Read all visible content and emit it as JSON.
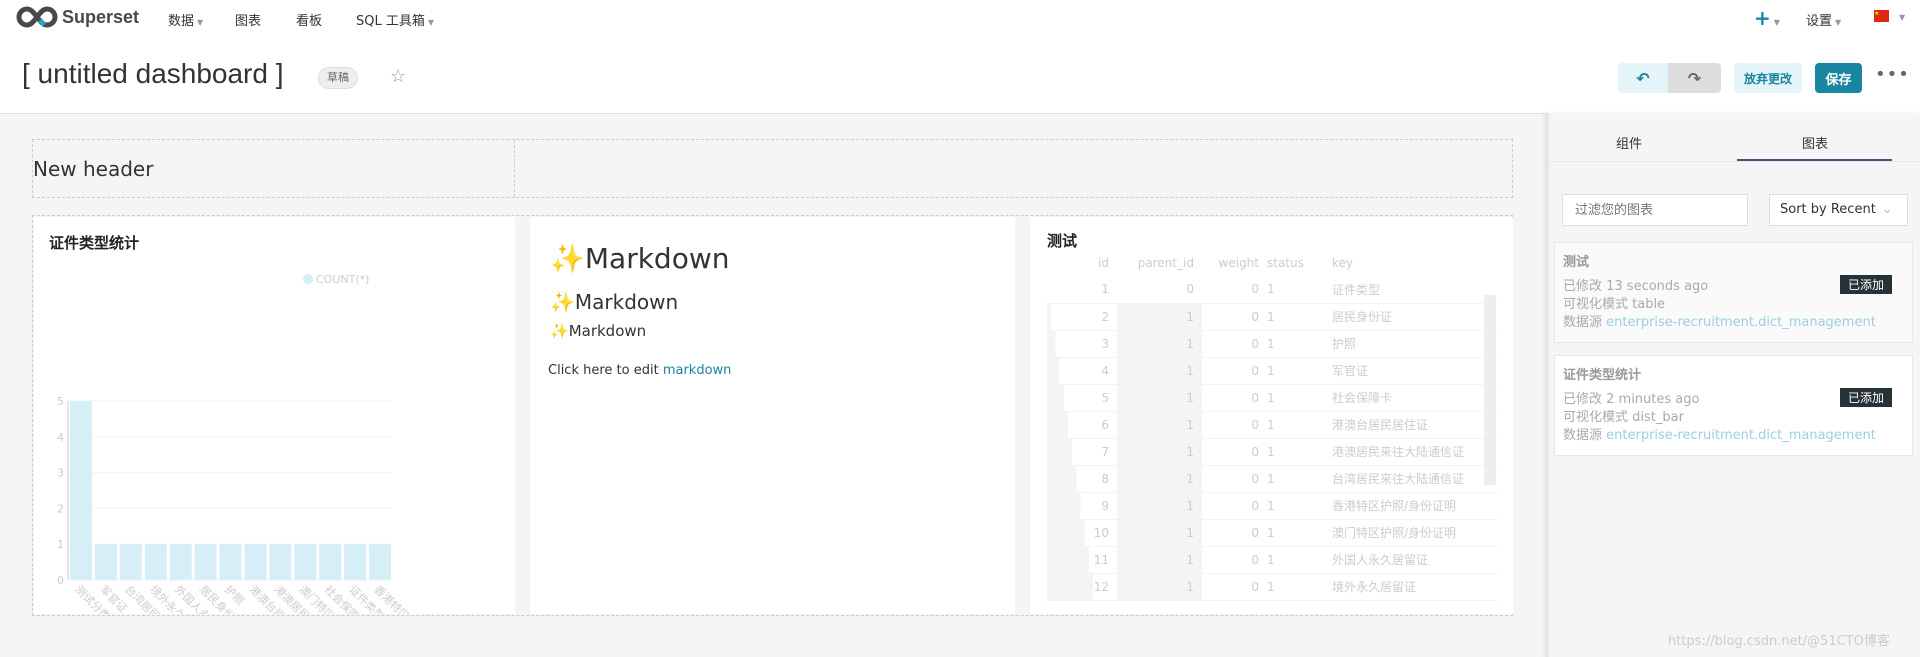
{
  "nav": {
    "brand": "Superset",
    "items": [
      {
        "label": "数据",
        "caret": true
      },
      {
        "label": "图表",
        "caret": false
      },
      {
        "label": "看板",
        "caret": false
      },
      {
        "label": "SQL 工具箱",
        "caret": true
      }
    ],
    "plus_icon": "plus-icon",
    "settings": "设置",
    "language_icon": "china-flag-icon"
  },
  "header": {
    "title": "[ untitled dashboard ]",
    "badge": "草稿",
    "undo_icon": "undo-icon",
    "redo_icon": "redo-icon",
    "discard": "放弃更改",
    "save": "保存",
    "more_icon": "ellipsis-icon"
  },
  "colors": {
    "primary": "#1a85a0",
    "bar": "#d6eef5",
    "dark": "#263238"
  },
  "dashboard": {
    "header_text": "New header",
    "chart1": {
      "title": "证件类型统计"
    },
    "markdown": {
      "h1": "Markdown",
      "h2": "Markdown",
      "h3": "Markdown",
      "edit_prefix": "Click here to edit ",
      "edit_link": "markdown"
    },
    "table": {
      "title": "测试",
      "columns": [
        "id",
        "parent_id",
        "weight",
        "status",
        "key"
      ],
      "rows": [
        [
          1,
          0,
          0,
          1,
          "证件类型"
        ],
        [
          2,
          1,
          0,
          1,
          "居民身份证"
        ],
        [
          3,
          1,
          0,
          1,
          "护照"
        ],
        [
          4,
          1,
          0,
          1,
          "军官证"
        ],
        [
          5,
          1,
          0,
          1,
          "社会保障卡"
        ],
        [
          6,
          1,
          0,
          1,
          "港澳台居民居住证"
        ],
        [
          7,
          1,
          0,
          1,
          "港澳居民来往大陆通信证"
        ],
        [
          8,
          1,
          0,
          1,
          "台湾居民来往大陆通信证"
        ],
        [
          9,
          1,
          0,
          1,
          "香港特区护照/身份证明"
        ],
        [
          10,
          1,
          0,
          1,
          "澳门特区护照/身份证明"
        ],
        [
          11,
          1,
          0,
          1,
          "外国人永久居留证"
        ],
        [
          12,
          1,
          0,
          1,
          "境外永久居留证"
        ]
      ]
    }
  },
  "chart_data": {
    "type": "bar",
    "title": "证件类型统计",
    "legend": "top-right",
    "ylim": [
      0,
      5
    ],
    "yticks": [
      0,
      1,
      2,
      3,
      4,
      5
    ],
    "grid": true,
    "categories": [
      "测试分类",
      "军官证",
      "台湾居民来往大陆通信证",
      "境外永久居留证",
      "外国人永久居留证",
      "居民身份证",
      "护照",
      "港澳台居民居住证",
      "港澳居民来往大陆通信证",
      "澳门特区护照/身份证明",
      "社会保障卡",
      "证件类型",
      "香港特区护照/身份证明"
    ],
    "series": [
      {
        "name": "COUNT(*)",
        "values": [
          5,
          1,
          1,
          1,
          1,
          1,
          1,
          1,
          1,
          1,
          1,
          1,
          1
        ]
      }
    ]
  },
  "sidebar": {
    "tabs": [
      "组件",
      "图表"
    ],
    "active_tab": 1,
    "filter_placeholder": "过滤您的图表",
    "sort": "Sort by Recent",
    "cards": [
      {
        "title": "测试",
        "modified": "已修改 13 seconds ago",
        "viz": "可视化模式 table",
        "ds_label": "数据源 ",
        "ds": "enterprise-recruitment.dict_management",
        "badge": "已添加"
      },
      {
        "title": "证件类型统计",
        "modified": "已修改 2 minutes ago",
        "viz": "可视化模式 dist_bar",
        "ds_label": "数据源 ",
        "ds": "enterprise-recruitment.dict_management",
        "badge": "已添加"
      }
    ]
  },
  "watermark": "https://blog.csdn.net/@51CTO博客"
}
